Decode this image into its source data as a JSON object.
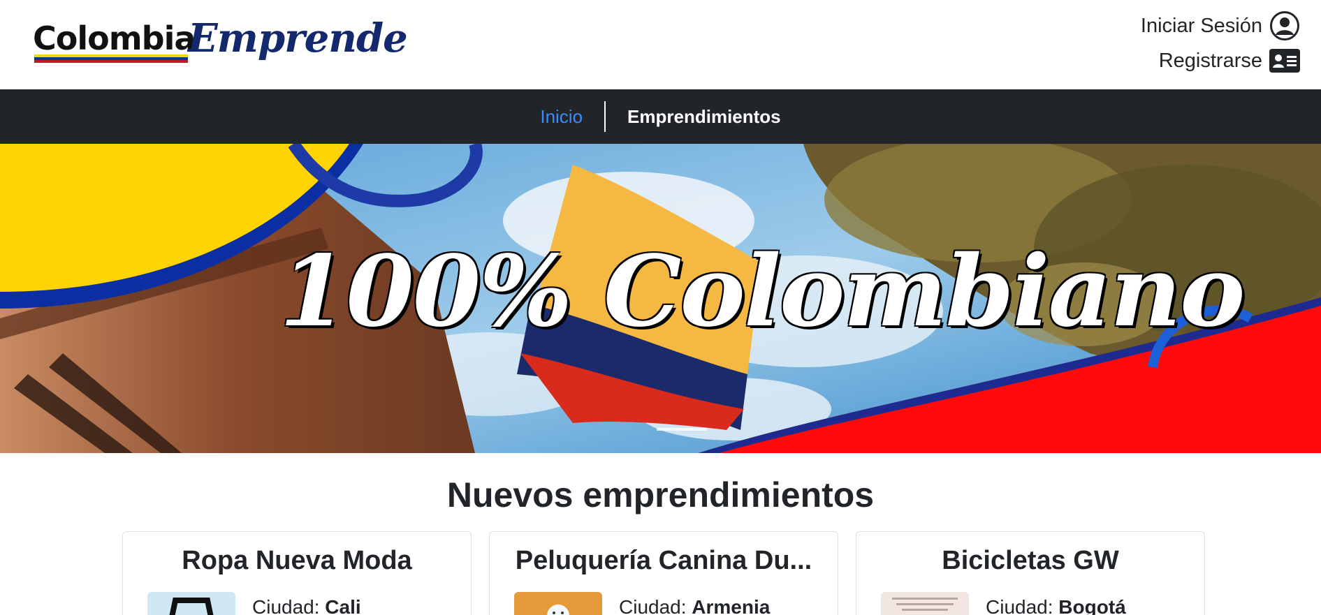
{
  "logo": {
    "part1": "Colombia",
    "part2": "Emprende"
  },
  "auth": {
    "login_label": "Iniciar Sesión",
    "register_label": "Registrarse",
    "login_icon": "user-circle-icon",
    "register_icon": "id-card-icon"
  },
  "nav": {
    "items": [
      {
        "label": "Inicio",
        "active": true
      },
      {
        "label": "Emprendimientos",
        "active": false
      }
    ]
  },
  "banner": {
    "text": "100% Colombiano"
  },
  "section": {
    "title": "Nuevos emprendimientos"
  },
  "cards": [
    {
      "title": "Ropa Nueva Moda",
      "city_label": "Ciudad:",
      "city": "Cali"
    },
    {
      "title": "Peluquería Canina Du...",
      "city_label": "Ciudad:",
      "city": "Armenia"
    },
    {
      "title": "Bicicletas GW",
      "city_label": "Ciudad:",
      "city": "Bogotá"
    }
  ],
  "colors": {
    "nav_bg": "#212529",
    "active_link": "#3d8bfd",
    "flag_yellow": "#fcd116",
    "flag_blue": "#003893",
    "flag_red": "#ce1126"
  }
}
